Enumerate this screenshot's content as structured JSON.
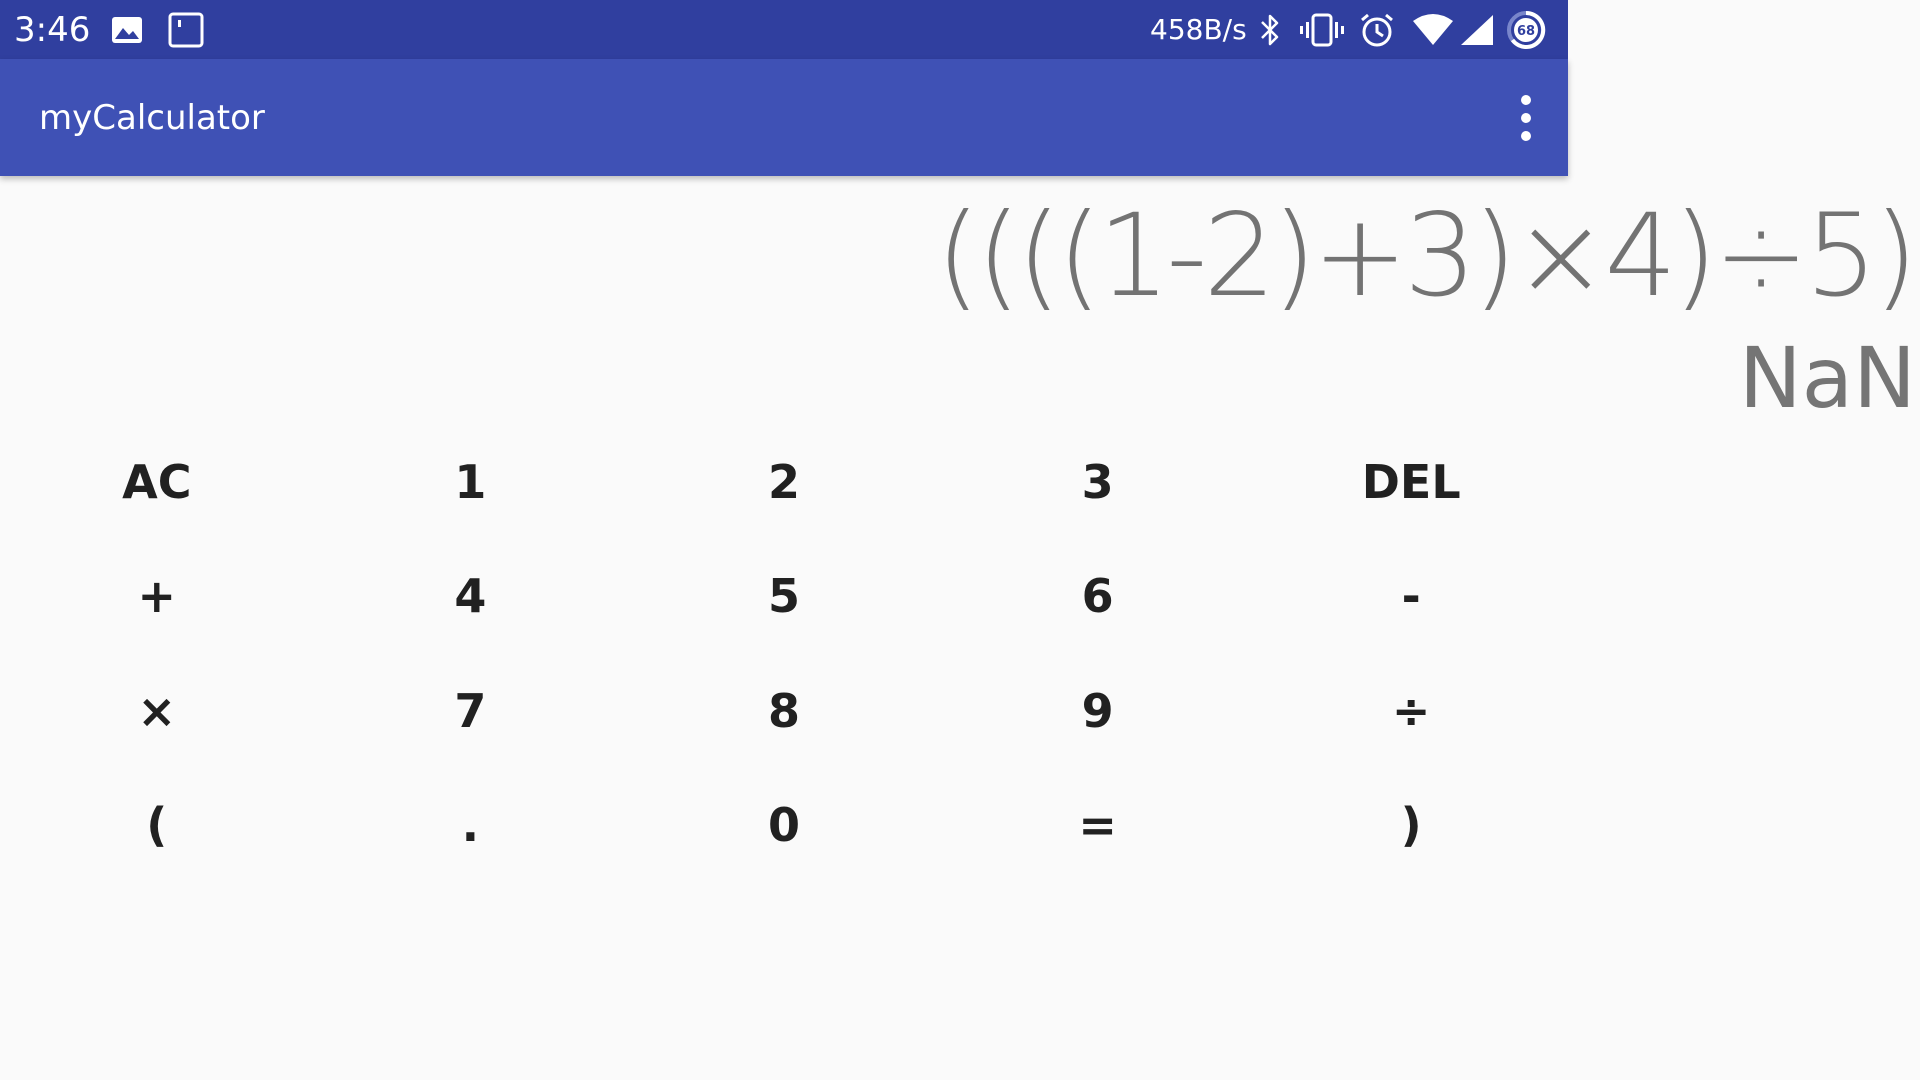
{
  "status_bar": {
    "time": "3:46",
    "network_speed": "458B/s",
    "battery_level": "68",
    "icons": [
      "image-icon",
      "notification-icon",
      "bluetooth-icon",
      "vibrate-icon",
      "alarm-icon",
      "wifi-icon",
      "signal-icon",
      "battery-icon"
    ]
  },
  "app_bar": {
    "title": "myCalculator",
    "menu_icon": "more-vert-icon"
  },
  "display": {
    "expression": "((((1-2)+3)×4)÷5)",
    "result": "NaN"
  },
  "keypad": {
    "keys": [
      "AC",
      "1",
      "2",
      "3",
      "DEL",
      "+",
      "4",
      "5",
      "6",
      "-",
      "×",
      "7",
      "8",
      "9",
      "÷",
      "(",
      ".",
      "0",
      "=",
      ")"
    ]
  },
  "colors": {
    "status_bar": "#303f9f",
    "app_bar": "#3f51b5",
    "background": "#fafafa",
    "display_text": "#737373",
    "key_text": "#212121"
  }
}
